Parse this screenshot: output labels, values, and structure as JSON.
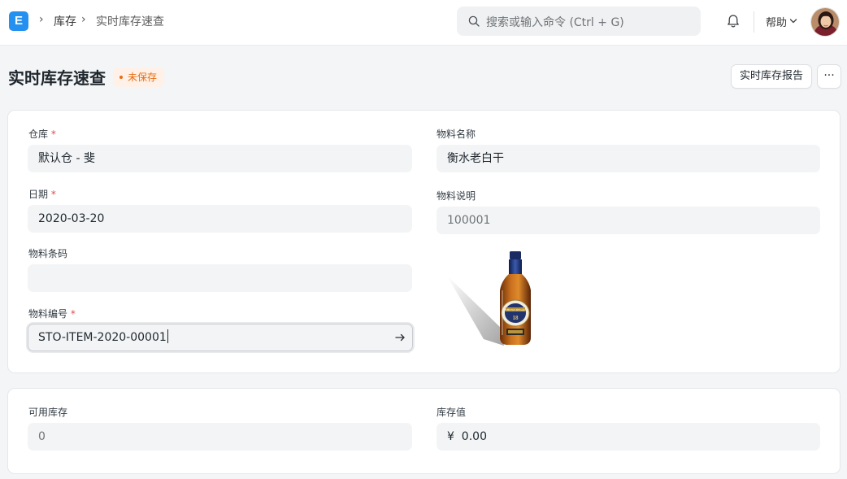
{
  "navbar": {
    "logo_letter": "E",
    "breadcrumbs": [
      "库存",
      "实时库存速查"
    ],
    "crumb_separator": "›",
    "search_placeholder": "搜索或输入命令 (Ctrl + G)",
    "help_label": "帮助"
  },
  "page": {
    "title": "实时库存速查",
    "status_badge": "未保存",
    "report_button": "实时库存报告",
    "more_button": "···"
  },
  "form": {
    "warehouse": {
      "label": "仓库",
      "required_mark": "*",
      "value": "默认仓 - 斐"
    },
    "date": {
      "label": "日期",
      "required_mark": "*",
      "value": "2020-03-20"
    },
    "item_barcode": {
      "label": "物料条码",
      "value": ""
    },
    "item_code": {
      "label": "物料编号",
      "required_mark": "*",
      "value": "STO-ITEM-2020-00001"
    },
    "item_name": {
      "label": "物料名称",
      "value": "衡水老白干"
    },
    "item_description": {
      "label": "物料说明",
      "value": "100001"
    },
    "available_qty": {
      "label": "可用库存",
      "value": "0"
    },
    "stock_value": {
      "label": "库存值",
      "value": "¥  0.00"
    }
  },
  "image": {
    "alt": "whisky-bottle",
    "label_text": "CHIVAS REGAL",
    "age": "18"
  },
  "colors": {
    "accent": "#2490ef",
    "badge_bg": "#fff1e7",
    "badge_text": "#e86c13",
    "required": "#e24c4c"
  },
  "icons": [
    "logo-icon",
    "chevron-right-icon",
    "search-icon",
    "bell-icon",
    "chevron-down-icon",
    "arrow-right-icon"
  ]
}
